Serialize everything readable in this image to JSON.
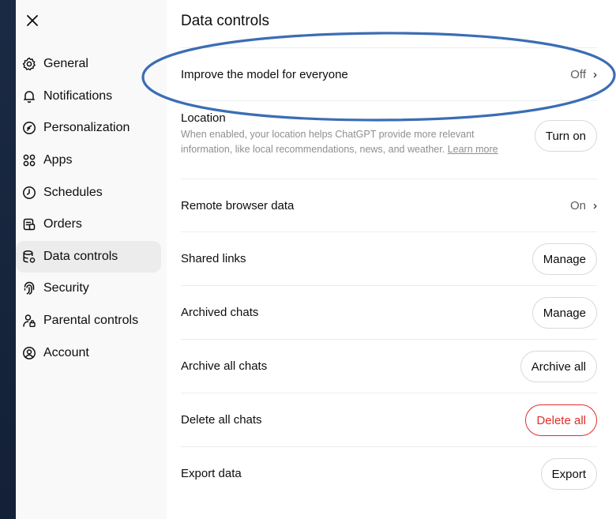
{
  "dialog": {
    "close_icon": "close-icon",
    "title": "Data controls"
  },
  "sidebar": {
    "items": [
      {
        "label": "General",
        "icon": "gear-icon"
      },
      {
        "label": "Notifications",
        "icon": "bell-icon"
      },
      {
        "label": "Personalization",
        "icon": "personalization-icon"
      },
      {
        "label": "Apps",
        "icon": "apps-grid-icon"
      },
      {
        "label": "Schedules",
        "icon": "clock-icon"
      },
      {
        "label": "Orders",
        "icon": "orders-icon"
      },
      {
        "label": "Data controls",
        "icon": "database-icon",
        "active": true
      },
      {
        "label": "Security",
        "icon": "fingerprint-icon"
      },
      {
        "label": "Parental controls",
        "icon": "parental-icon"
      },
      {
        "label": "Account",
        "icon": "account-icon"
      }
    ]
  },
  "settings": {
    "improve_model": {
      "label": "Improve the model for everyone",
      "value": "Off"
    },
    "location": {
      "label": "Location",
      "description": "When enabled, your location helps ChatGPT provide more relevant information, like local recommendations, news, and weather.",
      "link": "Learn more",
      "button": "Turn on"
    },
    "remote_browser": {
      "label": "Remote browser data",
      "value": "On"
    },
    "shared_links": {
      "label": "Shared links",
      "button": "Manage"
    },
    "archived_chats": {
      "label": "Archived chats",
      "button": "Manage"
    },
    "archive_all": {
      "label": "Archive all chats",
      "button": "Archive all"
    },
    "delete_all": {
      "label": "Delete all chats",
      "button": "Delete all"
    },
    "export": {
      "label": "Export data",
      "button": "Export"
    }
  },
  "colors": {
    "danger": "#e02e2a",
    "annotation": "#3b6db5",
    "sidebar_bg": "#f9f9f9"
  }
}
